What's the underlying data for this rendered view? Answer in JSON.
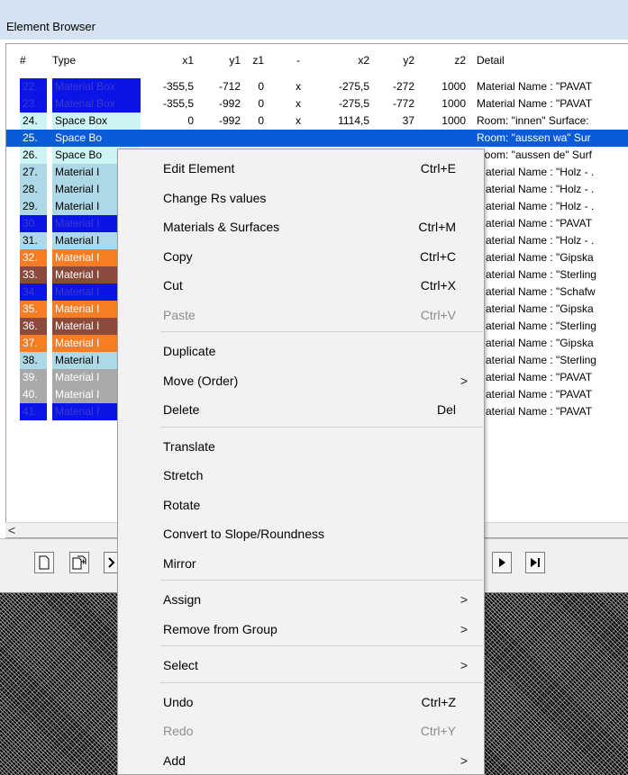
{
  "window": {
    "title": "Element Browser"
  },
  "columns": [
    "#",
    "Type",
    "x1",
    "y1",
    "z1",
    "-",
    "x2",
    "y2",
    "z2",
    "Detail"
  ],
  "rows": [
    {
      "idx": "22.",
      "type": "Material Box",
      "x1": "-355,5",
      "y1": "-712",
      "z1": "0",
      "sep": "x",
      "x2": "-275,5",
      "y2": "-272",
      "z2": "1000",
      "detail": "Material Name : \"PAVAT",
      "color": "#0a14e6",
      "text": "#3a3acd",
      "tcolor": "#000"
    },
    {
      "idx": "23.",
      "type": "Material Box",
      "x1": "-355,5",
      "y1": "-992",
      "z1": "0",
      "sep": "x",
      "x2": "-275,5",
      "y2": "-772",
      "z2": "1000",
      "detail": "Material Name : \"PAVAT",
      "color": "#0a14e6",
      "text": "#3a3acd",
      "tcolor": "#000"
    },
    {
      "idx": "24.",
      "type": "Space Box",
      "x1": "0",
      "y1": "-992",
      "z1": "0",
      "sep": "x",
      "x2": "1114,5",
      "y2": "37",
      "z2": "1000",
      "detail": "Room: \"innen\" Surface:",
      "color": "#cdf4f4",
      "text": "#000",
      "tcolor": "#000"
    },
    {
      "idx": "25.",
      "type": "Space Bo",
      "x1": "",
      "y1": "",
      "z1": "",
      "sep": "",
      "x2": "",
      "y2": "",
      "z2": "",
      "detail": "Room: \"aussen wa\" Sur",
      "color": "#aad2ee",
      "text": "#000",
      "tcolor": "#fff",
      "selected": true
    },
    {
      "idx": "26.",
      "type": "Space Bo",
      "x1": "",
      "y1": "",
      "z1": "",
      "sep": "",
      "x2": "",
      "y2": "",
      "z2": "",
      "detail": "Room: \"aussen de\" Surf",
      "color": "#cdf4f4",
      "text": "#000",
      "tcolor": "#000"
    },
    {
      "idx": "27.",
      "type": "Material I",
      "x1": "",
      "y1": "",
      "z1": "",
      "sep": "",
      "x2": "",
      "y2": "",
      "z2": "",
      "detail": "Material Name : \"Holz - .",
      "color": "#add8e6",
      "text": "#000",
      "tcolor": "#000"
    },
    {
      "idx": "28.",
      "type": "Material I",
      "x1": "",
      "y1": "",
      "z1": "",
      "sep": "",
      "x2": "",
      "y2": "",
      "z2": "",
      "detail": "Material Name : \"Holz - .",
      "color": "#add8e6",
      "text": "#000",
      "tcolor": "#000"
    },
    {
      "idx": "29.",
      "type": "Material I",
      "x1": "",
      "y1": "",
      "z1": "",
      "sep": "",
      "x2": "",
      "y2": "",
      "z2": "",
      "detail": "Material Name : \"Holz - .",
      "color": "#add8e6",
      "text": "#000",
      "tcolor": "#000"
    },
    {
      "idx": "30.",
      "type": "Material I",
      "x1": "",
      "y1": "",
      "z1": "",
      "sep": "",
      "x2": "",
      "y2": "",
      "z2": "",
      "detail": "Material Name : \"PAVAT",
      "color": "#0a14e6",
      "text": "#3a3acd",
      "tcolor": "#000"
    },
    {
      "idx": "31.",
      "type": "Material I",
      "x1": "",
      "y1": "",
      "z1": "",
      "sep": "",
      "x2": "",
      "y2": "",
      "z2": "",
      "detail": "Material Name : \"Holz - .",
      "color": "#add8e6",
      "text": "#000",
      "tcolor": "#000"
    },
    {
      "idx": "32.",
      "type": "Material I",
      "x1": "",
      "y1": "",
      "z1": "",
      "sep": "",
      "x2": "",
      "y2": "",
      "z2": "",
      "detail": "Material Name : \"Gipska",
      "color": "#f77d24",
      "text": "#fff",
      "tcolor": "#000"
    },
    {
      "idx": "33.",
      "type": "Material I",
      "x1": "",
      "y1": "",
      "z1": "",
      "sep": "",
      "x2": "",
      "y2": "",
      "z2": "",
      "detail": "Material Name : \"Sterling",
      "color": "#8c4a3c",
      "text": "#fff",
      "tcolor": "#000"
    },
    {
      "idx": "34.",
      "type": "Material I",
      "x1": "",
      "y1": "",
      "z1": "",
      "sep": "",
      "x2": "",
      "y2": "",
      "z2": "",
      "detail": "Material Name : \"Schafw",
      "color": "#0a14e6",
      "text": "#3a3acd",
      "tcolor": "#000"
    },
    {
      "idx": "35.",
      "type": "Material I",
      "x1": "",
      "y1": "",
      "z1": "",
      "sep": "",
      "x2": "",
      "y2": "",
      "z2": "",
      "detail": "Material Name : \"Gipska",
      "color": "#f77d24",
      "text": "#fff",
      "tcolor": "#000"
    },
    {
      "idx": "36.",
      "type": "Material I",
      "x1": "",
      "y1": "",
      "z1": "",
      "sep": "",
      "x2": "",
      "y2": "",
      "z2": "",
      "detail": "Material Name : \"Sterling",
      "color": "#8c4a3c",
      "text": "#fff",
      "tcolor": "#000"
    },
    {
      "idx": "37.",
      "type": "Material I",
      "x1": "",
      "y1": "",
      "z1": "",
      "sep": "",
      "x2": "",
      "y2": "",
      "z2": "",
      "detail": "Material Name : \"Gipska",
      "color": "#f77d24",
      "text": "#fff",
      "tcolor": "#000"
    },
    {
      "idx": "38.",
      "type": "Material I",
      "x1": "",
      "y1": "",
      "z1": "",
      "sep": "",
      "x2": "",
      "y2": "",
      "z2": "",
      "detail": "Material Name : \"Sterling",
      "color": "#add8e6",
      "text": "#000",
      "tcolor": "#000"
    },
    {
      "idx": "39.",
      "type": "Material I",
      "x1": "",
      "y1": "",
      "z1": "",
      "sep": "",
      "x2": "",
      "y2": "",
      "z2": "",
      "detail": "Material Name : \"PAVAT",
      "color": "#a9a9a9",
      "text": "#fff",
      "tcolor": "#000"
    },
    {
      "idx": "40.",
      "type": "Material I",
      "x1": "",
      "y1": "",
      "z1": "",
      "sep": "",
      "x2": "",
      "y2": "",
      "z2": "",
      "detail": "Material Name : \"PAVAT",
      "color": "#a9a9a9",
      "text": "#fff",
      "tcolor": "#000"
    },
    {
      "idx": "41.",
      "type": "Material I",
      "x1": "",
      "y1": "",
      "z1": "",
      "sep": "",
      "x2": "",
      "y2": "",
      "z2": "",
      "detail": "Material Name : \"PAVAT",
      "color": "#0a14e6",
      "text": "#3a3acd",
      "tcolor": "#000"
    }
  ],
  "hscroll": {
    "left_arrow": "<"
  },
  "toolbar": [
    {
      "name": "new-element-button",
      "icon": "page-icon",
      "glyph": "🗋"
    },
    {
      "name": "copy-element-button",
      "icon": "duplicate-page-icon",
      "glyph": "⧉"
    },
    {
      "name": "partial-button",
      "icon": "chevron-icon",
      "glyph": "❯"
    },
    {
      "name": "next-button",
      "icon": "play-icon",
      "glyph": "▶"
    },
    {
      "name": "last-button",
      "icon": "skip-end-icon",
      "glyph": "▶▌"
    }
  ],
  "menu": {
    "items": [
      {
        "label": "Edit Element",
        "shortcut": "Ctrl+E",
        "disabled": false,
        "submenu": false
      },
      {
        "label": "Change Rs values",
        "shortcut": "",
        "disabled": false,
        "submenu": false
      },
      {
        "label": "Materials & Surfaces",
        "shortcut": "Ctrl+M",
        "disabled": false,
        "submenu": false
      },
      {
        "label": "Copy",
        "shortcut": "Ctrl+C",
        "disabled": false,
        "submenu": false
      },
      {
        "label": "Cut",
        "shortcut": "Ctrl+X",
        "disabled": false,
        "submenu": false
      },
      {
        "label": "Paste",
        "shortcut": "Ctrl+V",
        "disabled": true,
        "submenu": false
      },
      {
        "separator": true
      },
      {
        "label": "Duplicate",
        "shortcut": "",
        "disabled": false,
        "submenu": false
      },
      {
        "label": "Move (Order)",
        "shortcut": "",
        "disabled": false,
        "submenu": true
      },
      {
        "label": "Delete",
        "shortcut": "Del",
        "disabled": false,
        "submenu": false
      },
      {
        "separator": true
      },
      {
        "label": "Translate",
        "shortcut": "",
        "disabled": false,
        "submenu": false
      },
      {
        "label": "Stretch",
        "shortcut": "",
        "disabled": false,
        "submenu": false
      },
      {
        "label": "Rotate",
        "shortcut": "",
        "disabled": false,
        "submenu": false
      },
      {
        "label": "Convert to Slope/Roundness",
        "shortcut": "",
        "disabled": false,
        "submenu": false
      },
      {
        "label": "Mirror",
        "shortcut": "",
        "disabled": false,
        "submenu": false
      },
      {
        "separator": true
      },
      {
        "label": "Assign",
        "shortcut": "",
        "disabled": false,
        "submenu": true
      },
      {
        "label": "Remove from Group",
        "shortcut": "",
        "disabled": false,
        "submenu": true
      },
      {
        "separator": true
      },
      {
        "label": "Select",
        "shortcut": "",
        "disabled": false,
        "submenu": true
      },
      {
        "separator": true
      },
      {
        "label": "Undo",
        "shortcut": "Ctrl+Z",
        "disabled": false,
        "submenu": false
      },
      {
        "label": "Redo",
        "shortcut": "Ctrl+Y",
        "disabled": true,
        "submenu": false
      },
      {
        "label": "Add",
        "shortcut": "",
        "disabled": false,
        "submenu": true
      }
    ],
    "submenu_glyph": ">"
  },
  "colors": {
    "selected_row": "#0a5bd8",
    "title_bar": "#d4e2f1"
  }
}
